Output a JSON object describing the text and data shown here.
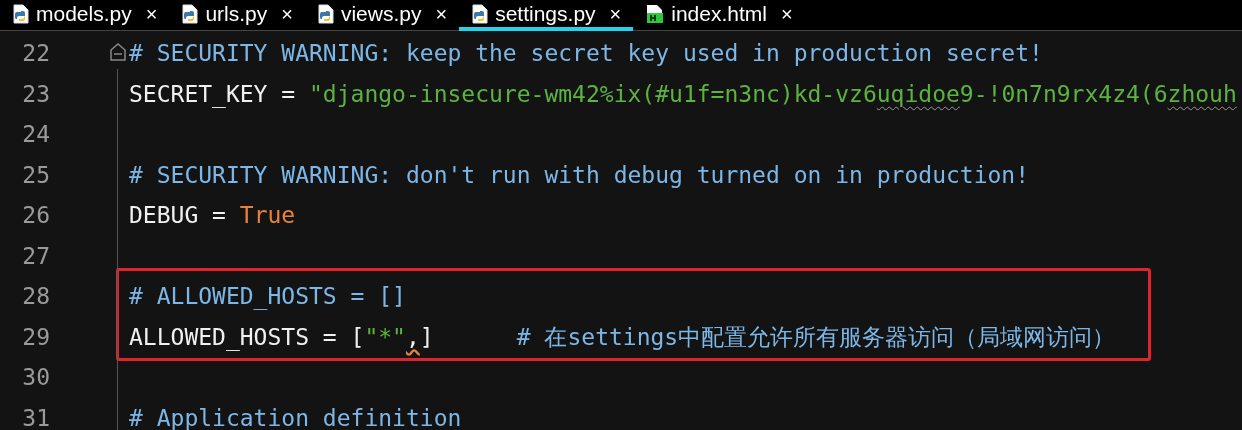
{
  "tabs": [
    {
      "label": "models.py",
      "kind": "python",
      "selected": false,
      "close": "×"
    },
    {
      "label": "urls.py",
      "kind": "python",
      "selected": false,
      "close": "×"
    },
    {
      "label": "views.py",
      "kind": "python",
      "selected": false,
      "close": "×"
    },
    {
      "label": "settings.py",
      "kind": "python",
      "selected": true,
      "close": "×"
    },
    {
      "label": "index.html",
      "kind": "html",
      "selected": false,
      "close": "×"
    }
  ],
  "editor": {
    "lines": [
      {
        "number": "22",
        "fold": true,
        "tokens": [
          {
            "kind": "comment",
            "text": "# SECURITY WARNING: keep the secret key used in production secret!"
          }
        ]
      },
      {
        "number": "23",
        "tokens": [
          {
            "kind": "plain",
            "text": "SECRET_KEY = "
          },
          {
            "kind": "string",
            "text": "\"django-insecure-wm42%ix(#u1f=n3nc)kd-vz6"
          },
          {
            "kind": "string",
            "text": "uqidoe",
            "warning": true
          },
          {
            "kind": "string",
            "text": "9-!0n7n9rx4z4(6"
          },
          {
            "kind": "string",
            "text": "zhouh",
            "warning": true
          }
        ]
      },
      {
        "number": "24"
      },
      {
        "number": "25",
        "tokens": [
          {
            "kind": "comment",
            "text": "# SECURITY WARNING: don't run with debug turned on in production!"
          }
        ]
      },
      {
        "number": "26",
        "tokens": [
          {
            "kind": "plain",
            "text": "DEBUG = "
          },
          {
            "kind": "keyword",
            "text": "True"
          }
        ]
      },
      {
        "number": "27"
      },
      {
        "number": "28",
        "highlighted": true,
        "tokens": [
          {
            "kind": "comment",
            "text": "# ALLOWED_HOSTS = []"
          }
        ]
      },
      {
        "number": "29",
        "highlighted": true,
        "tokens": [
          {
            "kind": "plain",
            "text": "ALLOWED_HOSTS = ["
          },
          {
            "kind": "string",
            "text": "\"*\""
          },
          {
            "kind": "plain",
            "text": ",",
            "warning": true
          },
          {
            "kind": "plain",
            "text": "]      "
          },
          {
            "kind": "comment",
            "text": "# 在settings中配置允许所有服务器访问（局域网访问）"
          }
        ]
      },
      {
        "number": "30"
      },
      {
        "number": "31",
        "tokens": [
          {
            "kind": "comment",
            "text": "# Application definition"
          }
        ]
      }
    ]
  }
}
